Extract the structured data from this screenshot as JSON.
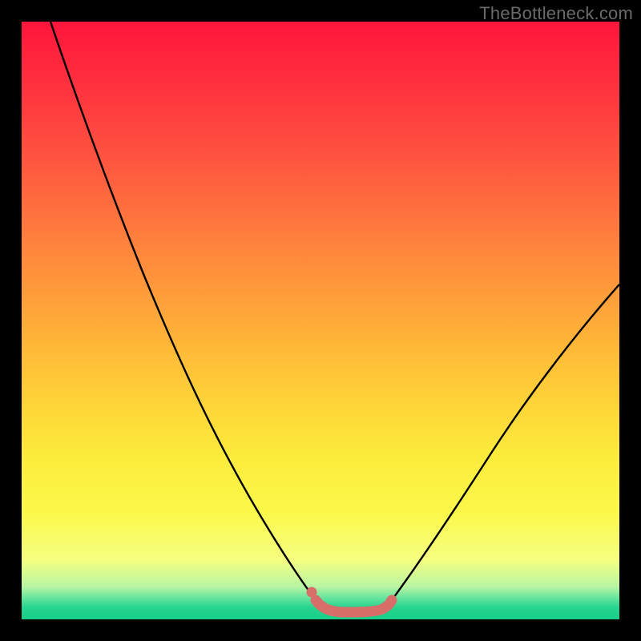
{
  "watermark": "TheBottleneck.com",
  "colors": {
    "frame": "#000000",
    "curve": "#000000",
    "marker": "#d76e6a",
    "gradient_top": "#ff153b",
    "gradient_bottom": "#18cf89"
  },
  "chart_data": {
    "type": "line",
    "title": "",
    "xlabel": "",
    "ylabel": "",
    "xlim": [
      0,
      100
    ],
    "ylim": [
      0,
      100
    ],
    "grid": false,
    "legend": false,
    "series": [
      {
        "name": "left-curve",
        "x": [
          5,
          10,
          15,
          20,
          25,
          30,
          35,
          40,
          45,
          49
        ],
        "values": [
          100,
          85,
          72,
          60,
          49,
          38,
          28,
          18,
          9,
          3
        ]
      },
      {
        "name": "right-curve",
        "x": [
          62,
          66,
          70,
          75,
          80,
          85,
          90,
          95,
          100
        ],
        "values": [
          3,
          6,
          10,
          16,
          23,
          31,
          39,
          47,
          56
        ]
      },
      {
        "name": "valley-marker",
        "x": [
          49,
          50,
          54,
          58,
          60,
          62
        ],
        "values": [
          3,
          1.2,
          0.8,
          0.8,
          1.2,
          3
        ]
      }
    ],
    "annotations": [
      {
        "type": "dot",
        "x": 48.5,
        "y": 4.2
      }
    ]
  }
}
